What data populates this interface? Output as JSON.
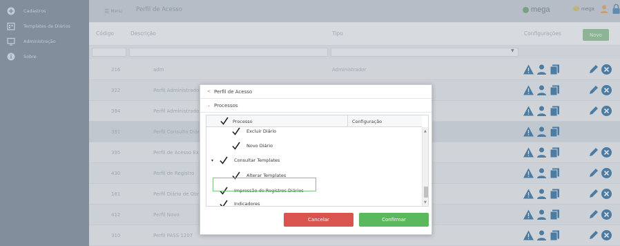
{
  "sidebar": {
    "items": [
      {
        "label": "Cadastros",
        "icon": "plus-circle-icon"
      },
      {
        "label": "Templates de Diários",
        "icon": "calendar-icon"
      },
      {
        "label": "Administração",
        "icon": "monitor-icon"
      },
      {
        "label": "Sobre",
        "icon": "info-icon"
      }
    ]
  },
  "topbar": {
    "menu_label": "Menu",
    "title": "Perfil de Acesso",
    "brand1": "mega",
    "brand2": "mega"
  },
  "table": {
    "headers": {
      "codigo": "Código",
      "descricao": "Descrição",
      "tipo": "Tipo",
      "configuracoes": "Configurações"
    },
    "new_button": "Novo",
    "rows": [
      {
        "codigo": "216",
        "descricao": "adm",
        "tipo": "Administrador"
      },
      {
        "codigo": "322",
        "descricao": "Perfil Administrador Diá",
        "tipo": ""
      },
      {
        "codigo": "394",
        "descricao": "Perfil Administrador Di",
        "tipo": ""
      },
      {
        "codigo": "391",
        "descricao": "Perfil Consulta Diário",
        "tipo": ""
      },
      {
        "codigo": "395",
        "descricao": "Perfil de Acesso Exemp",
        "tipo": ""
      },
      {
        "codigo": "430",
        "descricao": "Perfil de Registro",
        "tipo": ""
      },
      {
        "codigo": "181",
        "descricao": "Perfil Diário de Obras P",
        "tipo": ""
      },
      {
        "codigo": "412",
        "descricao": "Perfil Novo",
        "tipo": ""
      },
      {
        "codigo": "310",
        "descricao": "Perfil PASS 1207",
        "tipo": ""
      }
    ]
  },
  "modal": {
    "section1": "Perfil de Acesso",
    "section2": "Processos",
    "tree_header": {
      "col1": "Processo",
      "col2": "Configuração"
    },
    "nodes": {
      "excluir_diario": "Excluir Diário",
      "novo_diario": "Novo Diário",
      "consultar_templates": "Consultar Templates",
      "alterar_templates": "Alterar Templates",
      "impressao": "Impressão de Registros Diários",
      "indicadores": "Indicadores"
    },
    "cancel_label": "Cancelar",
    "confirm_label": "Confirmar"
  },
  "colors": {
    "sidebar": "#7b8a9a",
    "cancel": "#d9534f",
    "confirm": "#5cb85c",
    "icon_blue": "#2c6fa5"
  }
}
